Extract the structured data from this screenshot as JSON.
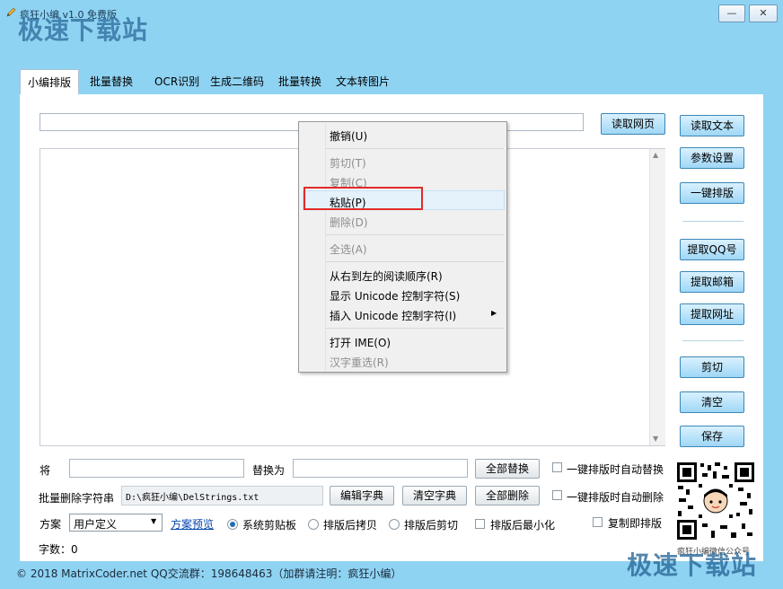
{
  "window": {
    "title": "疯狂小编 v1.0 免费版",
    "watermark": "极速下载站",
    "minimize_label": "—",
    "close_label": "✕"
  },
  "tabs": [
    {
      "label": "小编排版",
      "active": true
    },
    {
      "label": "批量替换"
    },
    {
      "label": "OCR识别"
    },
    {
      "label": "生成二维码"
    },
    {
      "label": "批量转换"
    },
    {
      "label": "文本转图片"
    }
  ],
  "toolbar": {
    "url_value": "",
    "read_web_label": "读取网页"
  },
  "side_buttons": {
    "read_text": "读取文本",
    "param_settings": "参数设置",
    "one_click_layout": "一键排版",
    "extract_qq": "提取QQ号",
    "extract_email": "提取邮箱",
    "extract_url": "提取网址",
    "cut": "剪切",
    "clear": "清空",
    "save": "保存"
  },
  "context_menu": {
    "undo": "撤销(U)",
    "cut": "剪切(T)",
    "copy": "复制(C)",
    "paste": "粘贴(P)",
    "delete": "删除(D)",
    "select_all": "全选(A)",
    "rtl": "从右到左的阅读顺序(R)",
    "show_unicode": "显示 Unicode 控制字符(S)",
    "insert_unicode": "插入 Unicode 控制字符(I)",
    "open_ime": "打开 IME(O)",
    "reconversion": "汉字重选(R)"
  },
  "replace_row": {
    "find_label": "将",
    "find_value": "",
    "replace_label": "替换为",
    "replace_value": "",
    "replace_all_label": "全部替换",
    "auto_replace_label": "一键排版时自动替换"
  },
  "delete_row": {
    "label": "批量删除字符串",
    "path": "D:\\疯狂小编\\DelStrings.txt",
    "edit_dict_label": "编辑字典",
    "clear_dict_label": "清空字典",
    "delete_all_label": "全部删除",
    "auto_delete_label": "一键排版时自动删除"
  },
  "scheme_row": {
    "label": "方案",
    "selected": "用户定义",
    "preview_link": "方案预览",
    "radio_clipboard": "系统剪贴板",
    "radio_copy_after": "排版后拷贝",
    "radio_cut_after": "排版后剪切",
    "check_minimize": "排版后最小化",
    "check_copy_layout": "复制即排版"
  },
  "word_count": "字数：0",
  "qr_caption": "疯狂小编微信公众号",
  "footer": "© 2018 MatrixCoder.net    QQ交流群：198648463（加群请注明：疯狂小编）"
}
